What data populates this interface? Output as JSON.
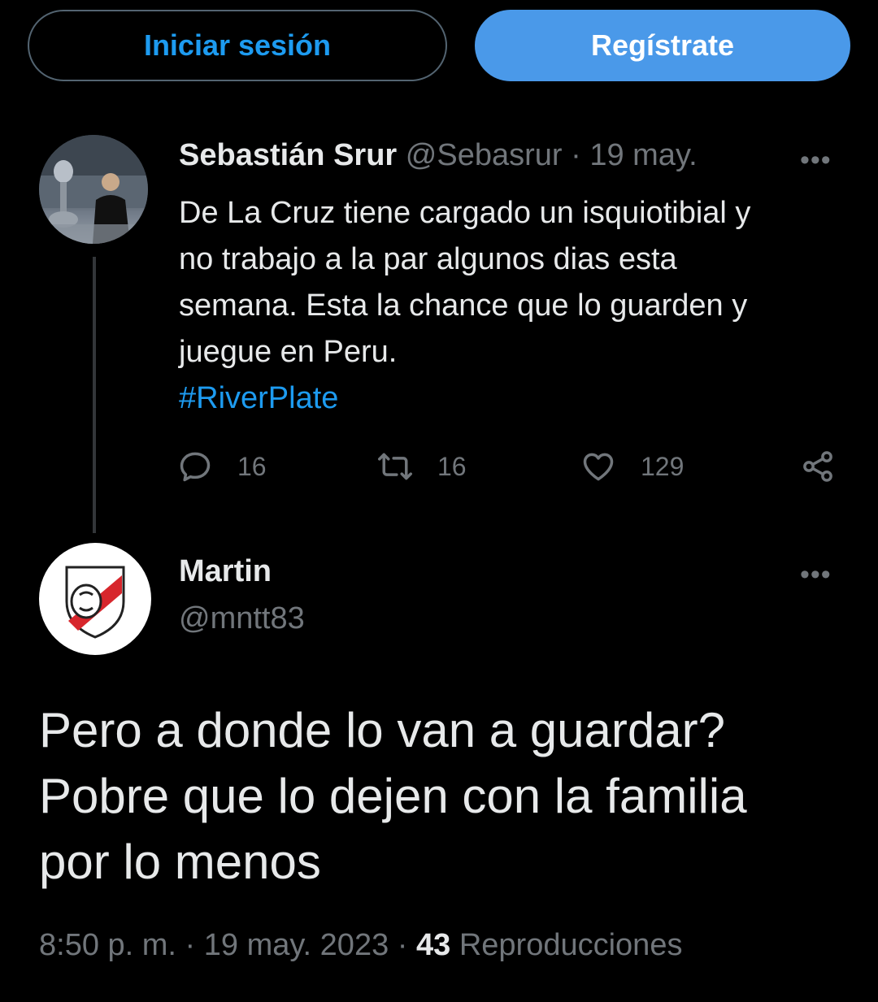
{
  "header": {
    "login_label": "Iniciar sesión",
    "signup_label": "Regístrate"
  },
  "quoted_tweet": {
    "author_name": "Sebastián Srur",
    "handle": "@Sebasrur",
    "separator": " · ",
    "date": "19 may.",
    "more_icon": "•••",
    "lines": [
      "De La Cruz tiene cargado un isquiotibial y",
      "no trabajo a la par algunos dias esta",
      "semana. Esta la chance que lo guarden y",
      "juegue en Peru."
    ],
    "hashtag": "#RiverPlate",
    "replies": "16",
    "retweets": "16",
    "likes": "129"
  },
  "reply_tweet": {
    "author_name": "Martin",
    "handle": "@mntt83",
    "more_icon": "•••",
    "lines": [
      "Pero a donde lo van a guardar?",
      "Pobre que lo dejen con la familia",
      "por lo menos"
    ],
    "time": "8:50 p. m.",
    "separator": " · ",
    "date": "19 may. 2023",
    "views_count": "43",
    "views_label": "Reproducciones"
  },
  "colors": {
    "background": "#000000",
    "accent": "#1d9bf0",
    "signup_bg": "#4a99e9",
    "muted": "#71767b"
  },
  "icons": [
    "reply-icon",
    "retweet-icon",
    "like-icon",
    "share-icon",
    "more-icon",
    "river-plate-logo"
  ]
}
